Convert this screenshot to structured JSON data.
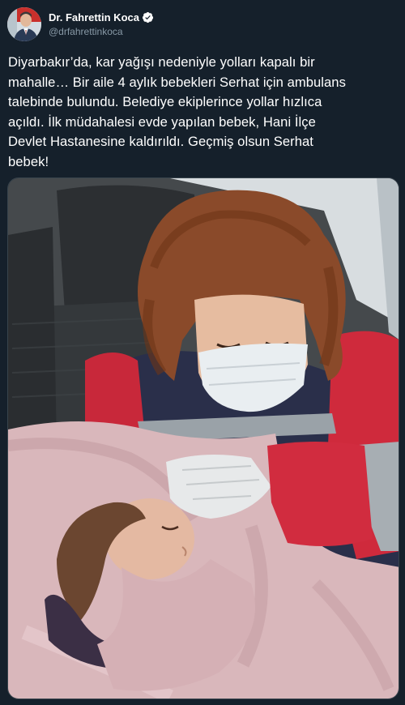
{
  "tweet": {
    "author": {
      "display_name": "Dr. Fahrettin Koca",
      "handle": "@drfahrettinkoca",
      "verified": true,
      "avatar_icon": "profile-photo"
    },
    "text": "Diyarbakır’da, kar yağışı nedeniyle yolları kapalı bir\nmahalle… Bir aile 4 aylık bebekleri Serhat için ambulans\ntalebinde bulundu. Belediye ekiplerince yollar hızlıca\naçıldı. İlk müdahalesi evde yapılan bebek, Hani İlçe\nDevlet Hastanesine kaldırıldı. Geçmiş olsun Serhat\nbebek!",
    "media": {
      "type": "photo",
      "icon": "photo-paramedic-holding-baby"
    }
  },
  "colors": {
    "background": "#15202b",
    "text": "#ffffff",
    "secondary_text": "#8899a6",
    "verified_badge": "#ffffff"
  }
}
